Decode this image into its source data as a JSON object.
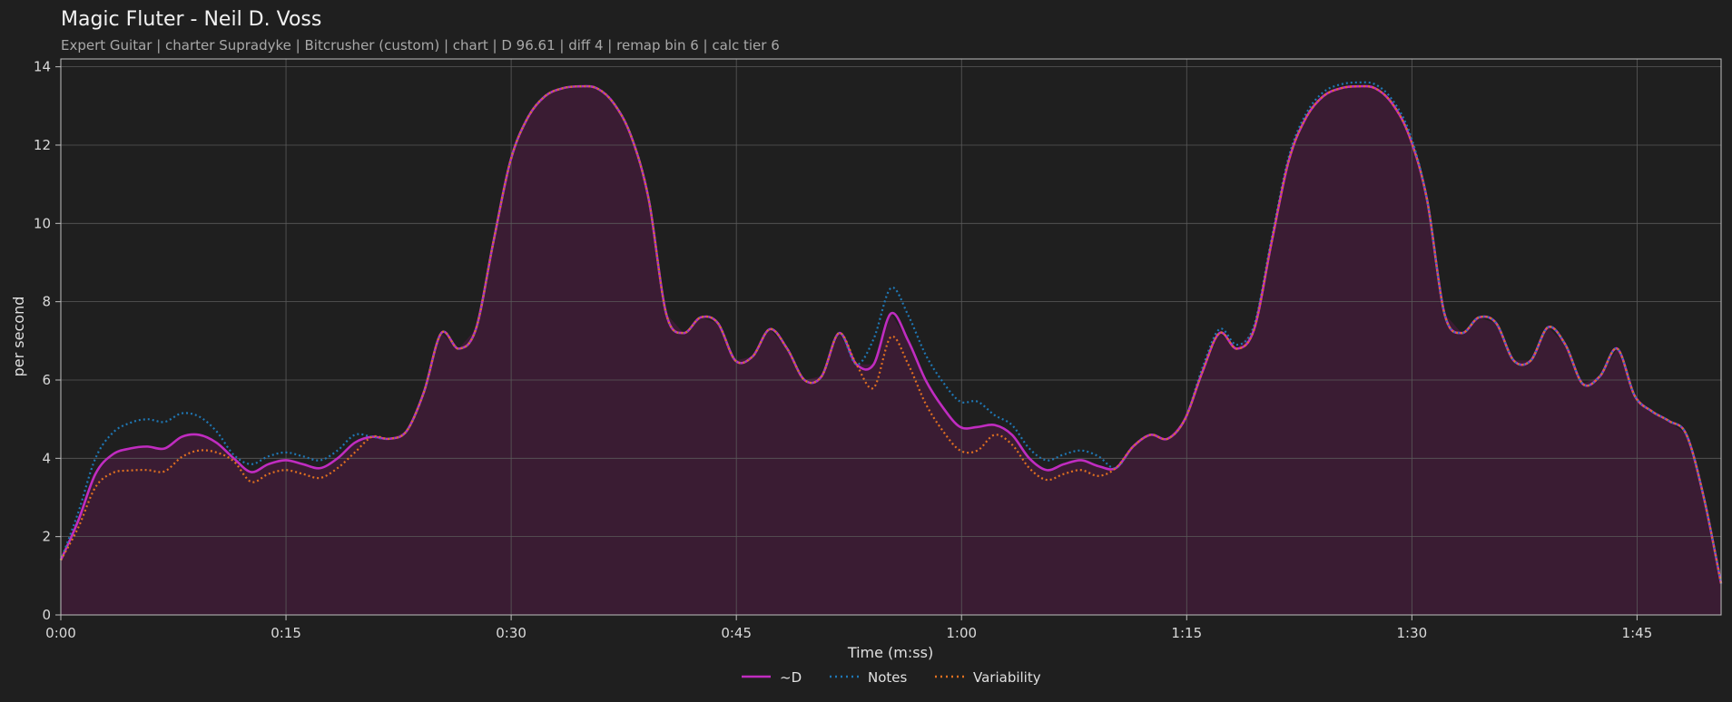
{
  "header": {
    "title": "Magic Fluter - Neil D. Voss",
    "subtitle": "Expert Guitar  |  charter Supradyke  |  Bitcrusher (custom)  |  chart  |  D 96.61  |  diff 4  |  remap bin 6  |  calc tier 6"
  },
  "chart_data": {
    "type": "line",
    "title": "Magic Fluter - Neil D. Voss",
    "subtitle": "Expert Guitar  |  charter Supradyke  |  Bitcrusher (custom)  |  chart  |  D 96.61  |  diff 4  |  remap bin 6  |  calc tier 6",
    "xlabel": "Time (m:ss)",
    "ylabel": "per second",
    "xlim": [
      0,
      110.6
    ],
    "ylim": [
      0,
      14.2
    ],
    "x_ticks": [
      0,
      15,
      30,
      45,
      60,
      75,
      90,
      105
    ],
    "x_tick_labels": [
      "0:00",
      "0:15",
      "0:30",
      "0:45",
      "1:00",
      "1:15",
      "1:30",
      "1:45"
    ],
    "y_ticks": [
      0,
      2,
      4,
      6,
      8,
      10,
      12,
      14
    ],
    "y_tick_labels": [
      "0",
      "2",
      "4",
      "6",
      "8",
      "10",
      "12",
      "14"
    ],
    "grid": true,
    "legend": "bottom-center",
    "x": [
      0,
      1,
      2,
      3,
      4,
      5,
      6,
      7,
      8,
      9,
      10,
      11,
      12,
      13,
      14,
      15,
      16,
      17,
      18,
      19,
      20,
      21,
      22,
      23,
      24,
      25,
      26,
      27,
      28,
      29,
      30,
      31,
      32,
      33,
      34,
      35,
      36,
      37,
      38,
      39,
      40,
      41,
      42,
      43,
      44,
      45,
      46,
      47,
      48,
      49,
      50,
      51,
      52,
      53,
      54,
      55,
      56,
      57,
      58,
      59,
      60,
      61,
      62,
      63,
      64,
      65,
      66,
      67,
      68,
      69,
      70,
      71,
      72,
      73,
      74,
      75,
      76,
      77,
      78,
      79,
      80,
      81,
      82,
      83,
      84,
      85,
      86,
      87,
      88,
      89,
      90,
      91,
      92,
      93,
      94,
      95,
      96,
      97,
      98,
      99,
      100,
      101,
      102,
      103,
      104,
      105,
      106,
      107,
      108,
      109,
      110,
      110.6
    ],
    "series": [
      {
        "name": "~D",
        "style": "solid",
        "color": "#c02cc0",
        "fill": "#3a1c33",
        "values": [
          1.4,
          2.4,
          3.6,
          4.1,
          4.25,
          4.3,
          4.25,
          4.55,
          4.6,
          4.4,
          4.0,
          3.65,
          3.85,
          3.95,
          3.85,
          3.75,
          4.0,
          4.4,
          4.55,
          4.5,
          4.7,
          5.7,
          7.2,
          6.8,
          7.3,
          9.5,
          11.6,
          12.7,
          13.25,
          13.45,
          13.5,
          13.45,
          13.05,
          12.2,
          10.6,
          7.7,
          7.2,
          7.6,
          7.45,
          6.5,
          6.6,
          7.3,
          6.8,
          6.0,
          6.1,
          7.2,
          6.4,
          6.4,
          7.7,
          7.0,
          6.0,
          5.3,
          4.8,
          4.8,
          4.85,
          4.6,
          4.0,
          3.7,
          3.85,
          3.95,
          3.8,
          3.75,
          4.3,
          4.6,
          4.5,
          5.0,
          6.2,
          7.2,
          6.8,
          7.3,
          9.5,
          11.6,
          12.7,
          13.25,
          13.45,
          13.5,
          13.45,
          13.05,
          12.2,
          10.6,
          7.7,
          7.2,
          7.6,
          7.45,
          6.5,
          6.5,
          7.35,
          6.9,
          5.9,
          6.1,
          6.8,
          5.6,
          5.2,
          4.95,
          4.6,
          3.0,
          0.8
        ],
        "x_index_note": ""
      }
    ]
  },
  "legend": {
    "d_label": "~D",
    "notes_label": "Notes",
    "variability_label": "Variability"
  },
  "colors": {
    "background": "#1f1f1f",
    "d_line": "#c02cc0",
    "d_fill": "#3a1c33",
    "notes_line": "#1f77b4",
    "variability_line": "#e07020",
    "grid": "#5a5a5a",
    "axis": "#bfbfbf"
  }
}
